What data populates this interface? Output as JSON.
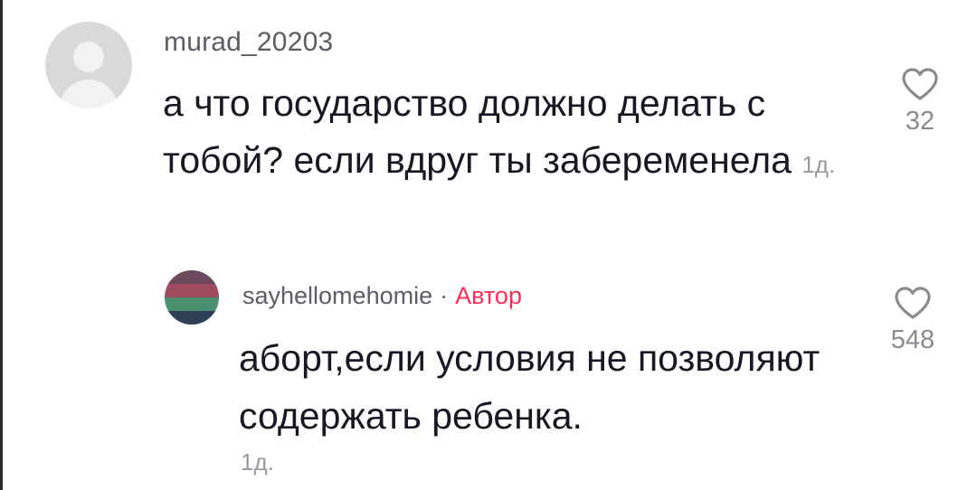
{
  "comment": {
    "username": "murad_20203",
    "text": "а что государство должно делать с тобой? если вдруг ты забеременела",
    "time": "1д.",
    "likes": "32",
    "avatar_icon": "default-user-icon"
  },
  "reply": {
    "username": "sayhellomehomie",
    "separator": "·",
    "author_badge": "Автор",
    "text": "аборт,если условия не позволяют содержать ребенка.",
    "time": "1д.",
    "likes": "548",
    "avatar_colors": [
      "#6b4a5e",
      "#a04a60",
      "#4a9070",
      "#2f3f55"
    ]
  },
  "colors": {
    "accent": "#fe2c55",
    "text": "#161823",
    "secondary": "#8a8b91"
  },
  "icons": {
    "like": "heart-outline-icon"
  }
}
